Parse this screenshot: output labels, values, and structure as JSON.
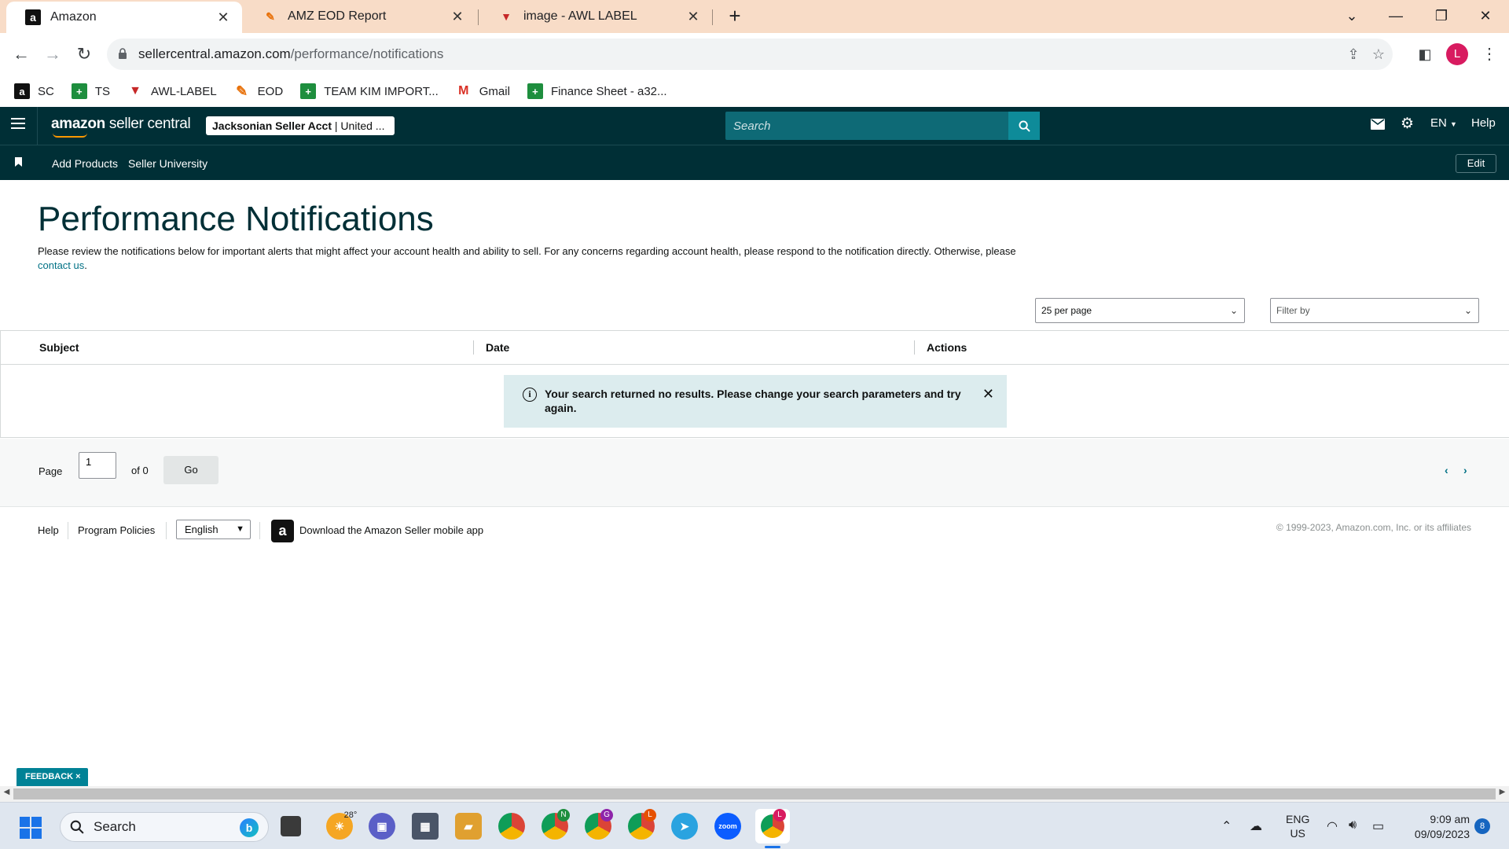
{
  "browser": {
    "tabs": [
      {
        "title": "Amazon",
        "icon": "amazon-favicon",
        "active": true
      },
      {
        "title": "AMZ EOD Report",
        "icon": "pencil-favicon",
        "active": false
      },
      {
        "title": "image - AWL LABEL",
        "icon": "awl-favicon",
        "active": false
      }
    ],
    "url_host": "sellercentral.amazon.com",
    "url_path": "/performance/notifications",
    "profile_initial": "L",
    "bookmarks": [
      {
        "label": "SC",
        "icon": "amazon-icon"
      },
      {
        "label": "TS",
        "icon": "sheets-icon"
      },
      {
        "label": "AWL-LABEL",
        "icon": "awl-icon"
      },
      {
        "label": "EOD",
        "icon": "pencil-icon"
      },
      {
        "label": "TEAM KIM IMPORT...",
        "icon": "sheets-icon"
      },
      {
        "label": "Gmail",
        "icon": "gmail-icon"
      },
      {
        "label": "Finance Sheet - a32...",
        "icon": "sheets-icon"
      }
    ]
  },
  "header": {
    "logo_bold": "amazon",
    "logo_light": " seller central",
    "account_bold": "Jacksonian Seller Acct",
    "account_rest": " | United ...",
    "search_placeholder": "Search",
    "language": "EN",
    "help": "Help",
    "nav_links": [
      "Add Products",
      "Seller University"
    ],
    "edit": "Edit"
  },
  "main": {
    "title": "Performance Notifications",
    "description_before_link": "Please review the notifications below for important alerts that might affect your account health and ability to sell. For any concerns regarding account health, please respond to the notification directly. Otherwise, please ",
    "description_link": "contact us",
    "description_after_link": ".",
    "per_page": "25 per page",
    "filter_placeholder": "Filter by",
    "columns": [
      "Subject",
      "Date",
      "Actions"
    ],
    "empty_message": "Your search returned no results. Please change your search parameters and try again.",
    "pagination": {
      "page_label": "Page",
      "page_value": "1",
      "of_label": "of 0",
      "go_label": "Go"
    }
  },
  "footer": {
    "help": "Help",
    "program_policies": "Program Policies",
    "language": "English",
    "app_download": "Download the Amazon Seller mobile app",
    "copyright": "© 1999-2023, Amazon.com, Inc. or its affiliates"
  },
  "feedback": "FEEDBACK ×",
  "taskbar": {
    "search": "Search",
    "weather": "28°",
    "lang_top": "ENG",
    "lang_bottom": "US",
    "time": "9:09 am",
    "date": "09/09/2023",
    "notifications": "8",
    "chrome_badges": [
      "N",
      "G",
      "L",
      "L"
    ]
  },
  "colors": {
    "header_bg": "#002f36",
    "accent": "#007185",
    "tabstrip": "#f8dcc7",
    "alert_bg": "#dcecee"
  }
}
